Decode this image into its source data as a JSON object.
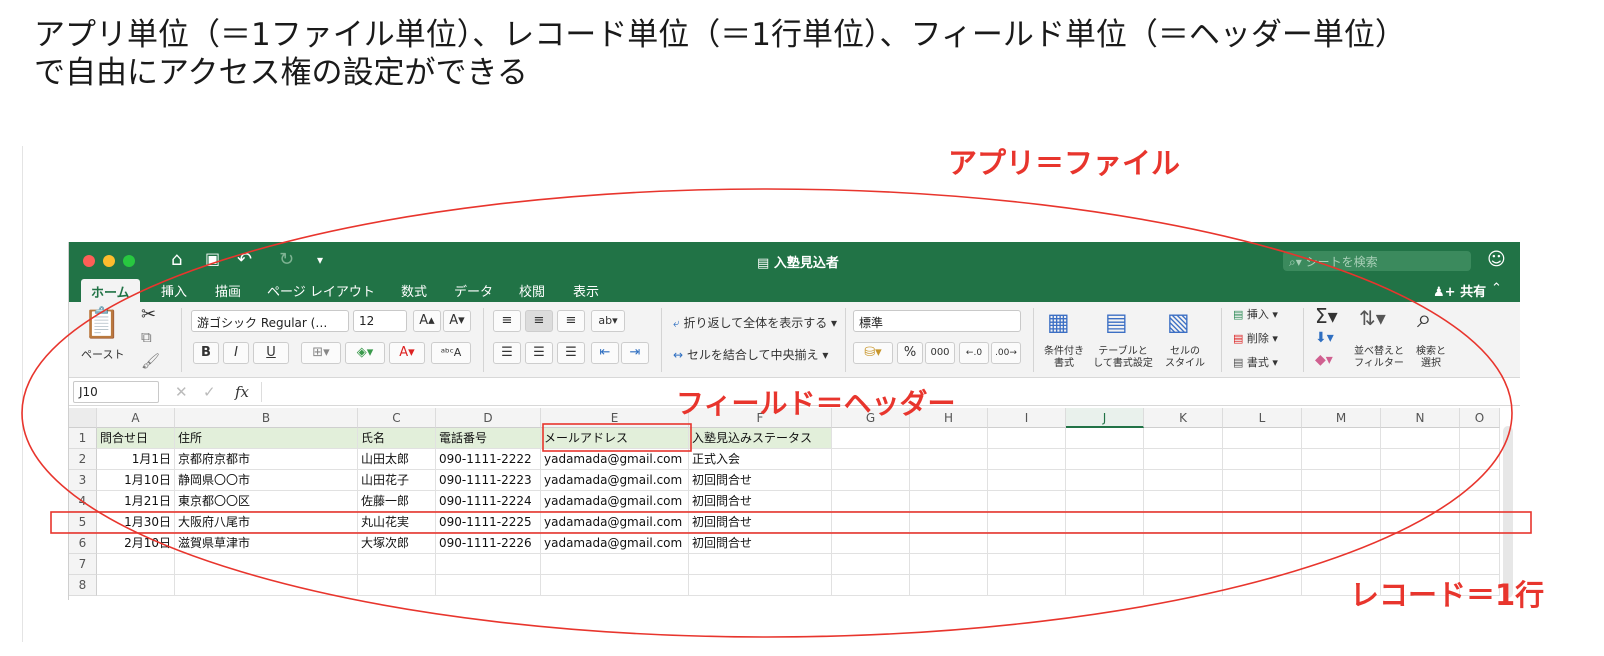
{
  "heading": {
    "line1": "アプリ単位（＝1ファイル単位）、レコード単位（＝1行単位）、フィールド単位（＝ヘッダー単位）",
    "line2": "で自由にアクセス権の設定ができる"
  },
  "annotations": {
    "app": "アプリ＝ファイル",
    "field": "フィールド＝ヘッダー",
    "record": "レコード＝1行",
    "color": "#e8352d"
  },
  "excel": {
    "accent": "#217346",
    "window_title": "入塾見込者",
    "search_placeholder": "シートを検索",
    "share_label": "共有",
    "tabs": [
      "ホーム",
      "挿入",
      "描画",
      "ページ レイアウト",
      "数式",
      "データ",
      "校閲",
      "表示"
    ],
    "ribbon": {
      "paste": "ペースト",
      "font_name": "游ゴシック Regular (…",
      "font_size": "12",
      "bold": "B",
      "italic": "I",
      "underline": "U",
      "wrap_text": "折り返して全体を表示する",
      "merge_center": "セルを結合して中央揃え",
      "number_format": "標準",
      "percent": "%",
      "comma": "000",
      "conditional_line1": "条件付き",
      "conditional_line2": "書式",
      "table_line1": "テーブルと",
      "table_line2": "して書式設定",
      "cell_style_line1": "セルの",
      "cell_style_line2": "スタイル",
      "insert": "挿入",
      "delete": "削除",
      "format": "書式",
      "sort_line1": "並べ替えと",
      "sort_line2": "フィルター",
      "find_line1": "検索と",
      "find_line2": "選択"
    },
    "name_box": "J10",
    "fx": "fx",
    "columns": [
      "A",
      "B",
      "C",
      "D",
      "E",
      "F",
      "G",
      "H",
      "I",
      "J",
      "K",
      "L",
      "M",
      "N",
      "O"
    ],
    "row_numbers": [
      "1",
      "2",
      "3",
      "4",
      "5",
      "6",
      "7",
      "8"
    ],
    "headers": [
      "問合せ日",
      "住所",
      "氏名",
      "電話番号",
      "メールアドレス",
      "入塾見込みステータス"
    ],
    "rows": [
      [
        "1月1日",
        "京都府京都市",
        "山田太郎",
        "090-1111-2222",
        "yadamada@gmail.com",
        "正式入会"
      ],
      [
        "1月10日",
        "静岡県〇〇市",
        "山田花子",
        "090-1111-2223",
        "yadamada@gmail.com",
        "初回問合せ"
      ],
      [
        "1月21日",
        "東京都〇〇区",
        "佐藤一郎",
        "090-1111-2224",
        "yadamada@gmail.com",
        "初回問合せ"
      ],
      [
        "1月30日",
        "大阪府八尾市",
        "丸山花実",
        "090-1111-2225",
        "yadamada@gmail.com",
        "初回問合せ"
      ],
      [
        "2月10日",
        "滋賀県草津市",
        "大塚次郎",
        "090-1111-2226",
        "yadamada@gmail.com",
        "初回問合せ"
      ]
    ]
  }
}
